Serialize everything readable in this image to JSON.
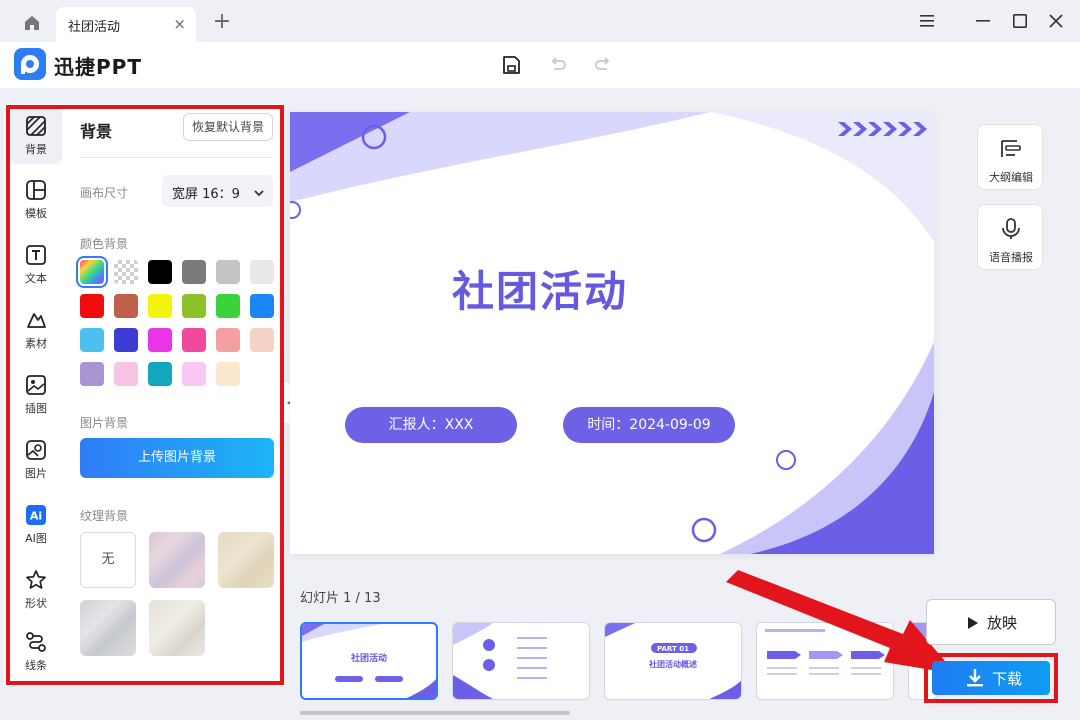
{
  "tab": {
    "title": "社团活动",
    "close": "×",
    "add": "+"
  },
  "app": {
    "name": "迅捷PPT",
    "logo_letter": "P"
  },
  "nav": [
    {
      "label": "背景",
      "icon": "background-icon"
    },
    {
      "label": "模板",
      "icon": "template-icon"
    },
    {
      "label": "文本",
      "icon": "text-icon"
    },
    {
      "label": "素材",
      "icon": "material-icon"
    },
    {
      "label": "插图",
      "icon": "illustration-icon"
    },
    {
      "label": "图片",
      "icon": "image-icon"
    },
    {
      "label": "AI图",
      "icon": "ai-image-icon"
    },
    {
      "label": "形状",
      "icon": "shape-icon"
    },
    {
      "label": "线条",
      "icon": "line-icon"
    }
  ],
  "panel": {
    "title": "背景",
    "reset_label": "恢复默认背景",
    "canvas_size_label": "画布尺寸",
    "ratio_value": "宽屏 16：9",
    "color_label": "颜色背景",
    "image_label": "图片背景",
    "upload_label": "上传图片背景",
    "texture_label": "纹理背景",
    "texture_none": "无"
  },
  "swatches": [
    "gradient",
    "transparent",
    "#000000",
    "#7a7a7a",
    "#c4c4c4",
    "#e9e9e9",
    "#f20d0d",
    "#c0604a",
    "#f5f50a",
    "#8bc22a",
    "#3bd33b",
    "#1d86f5",
    "#4ec0ee",
    "#3b3dd4",
    "#e935e6",
    "#ef4a9e",
    "#f4a0a0",
    "#f6d3c7",
    "#a896d2",
    "#f7c4e6",
    "#12a7bf",
    "#fac8f4",
    "#fce7cf"
  ],
  "slide": {
    "title": "社团活动",
    "reporter": "汇报人：XXX",
    "time": "时间：2024-09-09"
  },
  "side_tools": {
    "outline": "大纲编辑",
    "voice": "语音播报"
  },
  "bottom": {
    "slide_counter": "幻灯片 1 / 13",
    "play_label": "放映",
    "download_label": "下载",
    "thumb1_title": "社团活动",
    "thumb3_part": "PART 01",
    "thumb3_title": "社团活动概述"
  },
  "colors": {
    "accent": "#2f7cf6",
    "slide_purple": "#6459e0",
    "highlight": "#e2141c"
  }
}
